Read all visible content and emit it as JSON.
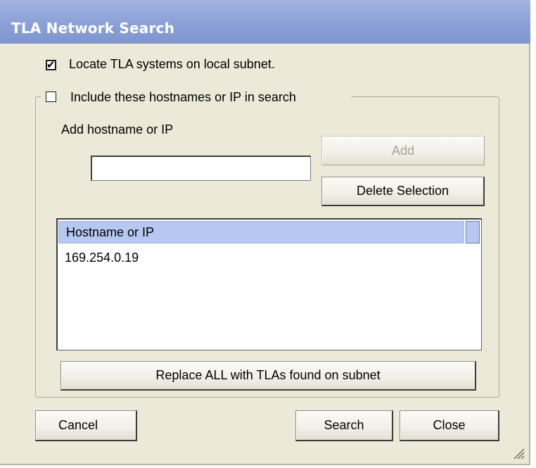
{
  "window": {
    "title": "TLA Network Search"
  },
  "local_subnet": {
    "checked": true,
    "label": "Locate TLA systems on local subnet."
  },
  "include_hosts": {
    "checked": false,
    "label": "Include these hostnames or IP in search",
    "add_label": "Add hostname or IP",
    "input_value": "",
    "add_button": "Add",
    "delete_button": "Delete Selection",
    "list_header": "Hostname or IP",
    "rows": [
      "169.254.0.19"
    ],
    "replace_button": "Replace ALL with TLAs found on subnet"
  },
  "footer": {
    "cancel_button": "Cancel",
    "search_button": "Search",
    "close_button": "Close"
  }
}
